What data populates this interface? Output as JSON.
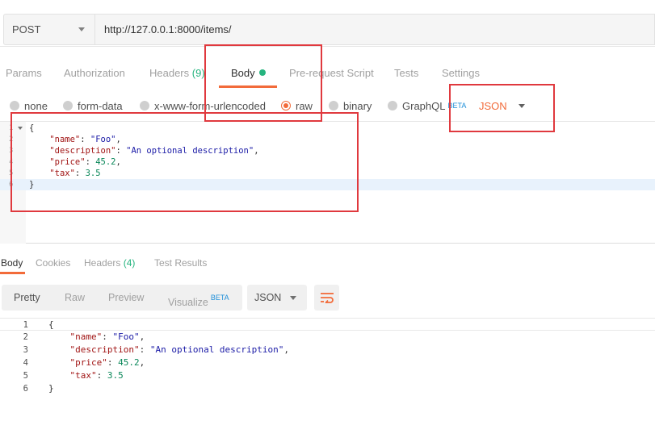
{
  "request": {
    "method": "POST",
    "url": "http://127.0.0.1:8000/items/"
  },
  "request_tabs": [
    {
      "label": "Params"
    },
    {
      "label": "Authorization"
    },
    {
      "label": "Headers",
      "count": "(9)"
    },
    {
      "label": "Body",
      "active": true
    },
    {
      "label": "Pre-request Script"
    },
    {
      "label": "Tests"
    },
    {
      "label": "Settings"
    }
  ],
  "body_types": [
    {
      "label": "none"
    },
    {
      "label": "form-data"
    },
    {
      "label": "x-www-form-urlencoded"
    },
    {
      "label": "raw",
      "selected": true
    },
    {
      "label": "binary"
    },
    {
      "label": "GraphQL",
      "badge": "BETA"
    }
  ],
  "body_language": "JSON",
  "request_body": {
    "line_numbers": [
      "1",
      "2",
      "3",
      "4",
      "5",
      "6"
    ],
    "lines": [
      "{",
      "    \"name\": \"Foo\",",
      "    \"description\": \"An optional description\",",
      "    \"price\": 45.2,",
      "    \"tax\": 3.5",
      "}"
    ]
  },
  "response_tabs": [
    {
      "label": "Body",
      "active": true
    },
    {
      "label": "Cookies"
    },
    {
      "label": "Headers",
      "count": "(4)"
    },
    {
      "label": "Test Results"
    }
  ],
  "response_views": [
    {
      "label": "Pretty",
      "active": true
    },
    {
      "label": "Raw"
    },
    {
      "label": "Preview"
    },
    {
      "label": "Visualize",
      "badge": "BETA"
    }
  ],
  "response_format": "JSON",
  "response_body": {
    "line_numbers": [
      "1",
      "2",
      "3",
      "4",
      "5",
      "6"
    ],
    "lines": [
      "{",
      "    \"name\": \"Foo\",",
      "    \"description\": \"An optional description\",",
      "    \"price\": 45.2,",
      "    \"tax\": 3.5",
      "}"
    ]
  },
  "colors": {
    "accent": "#f26b3a",
    "count_green": "#26b47f",
    "beta_blue": "#1f8fd9",
    "annotation_red": "#e0393e",
    "json_key": "#a11515",
    "json_string": "#1a1aa6",
    "json_number": "#098658"
  },
  "icons": {
    "method_dropdown": "chevron-down-icon",
    "body_dirty": "green-dot-icon",
    "language_dropdown": "chevron-down-icon",
    "wrap_lines": "wrap-lines-icon"
  }
}
